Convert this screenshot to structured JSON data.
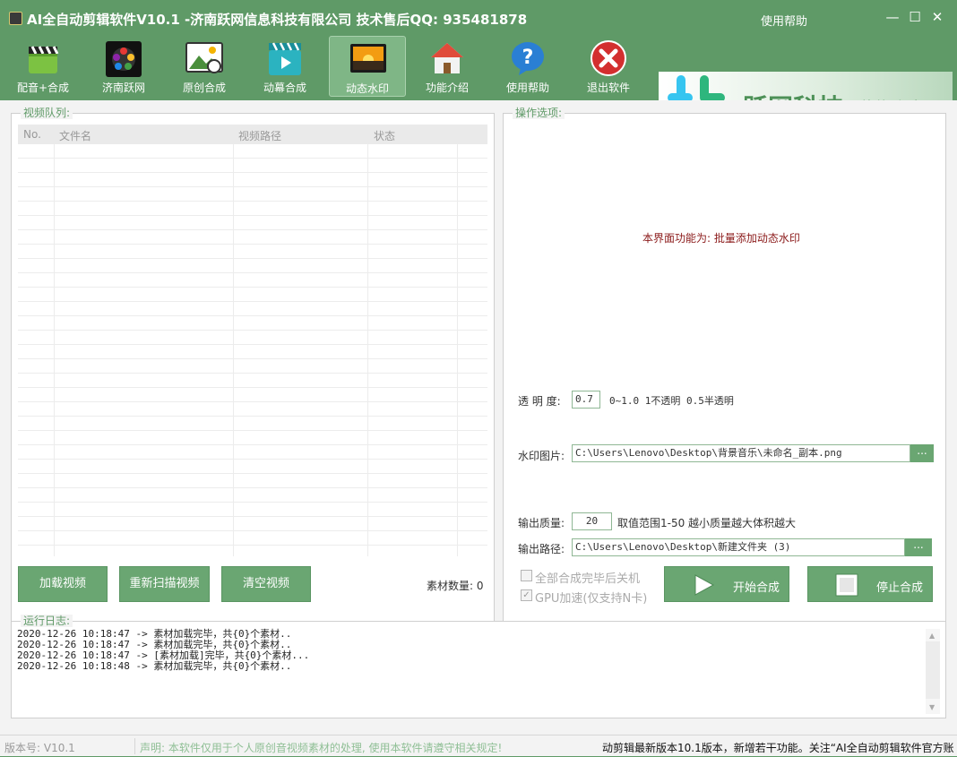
{
  "window": {
    "title": "AI全自动剪辑软件V10.1 -济南跃网信息科技有限公司 技术售后QQ: 935481878",
    "help_link": "使用帮助",
    "minimize": "—",
    "maximize": "☐",
    "close": "✕"
  },
  "toolbar": {
    "items": [
      {
        "label": "配音+合成",
        "icon": "clapperboard-icon"
      },
      {
        "label": "济南跃网",
        "icon": "film-reel-icon"
      },
      {
        "label": "原创合成",
        "icon": "picture-icon"
      },
      {
        "label": "动幕合成",
        "icon": "play-clapper-icon"
      },
      {
        "label": "动态水印",
        "icon": "sunset-image-icon",
        "active": true
      },
      {
        "label": "功能介绍",
        "icon": "home-icon"
      },
      {
        "label": "使用帮助",
        "icon": "question-icon"
      },
      {
        "label": "退出软件",
        "icon": "close-circle-icon"
      }
    ],
    "banner_title": "跃网科技",
    "banner_subtitle": "软件系列"
  },
  "video_queue": {
    "legend": "视频队列:",
    "columns": [
      "No.",
      "文件名",
      "视频路径",
      "状态"
    ],
    "rows": [],
    "buttons": {
      "load": "加载视频",
      "rescan": "重新扫描视频",
      "clear": "清空视频"
    },
    "count_label": "素材数量: 0"
  },
  "options": {
    "legend": "操作选项:",
    "feature_note": "本界面功能为: 批量添加动态水印",
    "opacity_label": "透 明 度:",
    "opacity_value": "0.7",
    "opacity_hint": "0~1.0 1不透明 0.5半透明",
    "watermark_label": "水印图片:",
    "watermark_path": "C:\\Users\\Lenovo\\Desktop\\背景音乐\\未命名_副本.png",
    "browse": "...",
    "quality_label": "输出质量:",
    "quality_value": "20",
    "quality_hint": "取值范围1-50 越小质量越大体积越大",
    "output_label": "输出路径:",
    "output_path": "C:\\Users\\Lenovo\\Desktop\\新建文件夹 (3)",
    "shutdown_label": "全部合成完毕后关机",
    "shutdown_checked": false,
    "gpu_label": "GPU加速(仅支持N卡)",
    "gpu_checked": true,
    "start_button": "开始合成",
    "stop_button": "停止合成"
  },
  "log": {
    "legend": "运行日志:",
    "lines": [
      "2020-12-26 10:18:47 -> 素材加载完毕，共{0}个素材..",
      "2020-12-26 10:18:47 -> 素材加载完毕，共{0}个素材..",
      "2020-12-26 10:18:47 -> [素材加载]完毕，共{0}个素材...",
      "2020-12-26 10:18:48 -> 素材加载完毕，共{0}个素材.."
    ]
  },
  "status_bar": {
    "version": "版本号: V10.1",
    "notice": "声明: 本软件仅用于个人原创音视频素材的处理, 使用本软件请遵守相关规定!",
    "marquee": "动剪辑最新版本10.1版本，新增若干功能。关注“AI全自动剪辑软件官方账"
  },
  "colors": {
    "theme_green": "#5f9a67",
    "button_green": "#6aa672",
    "legend_green": "#5f9a67",
    "note_red": "#8b1a1a"
  }
}
